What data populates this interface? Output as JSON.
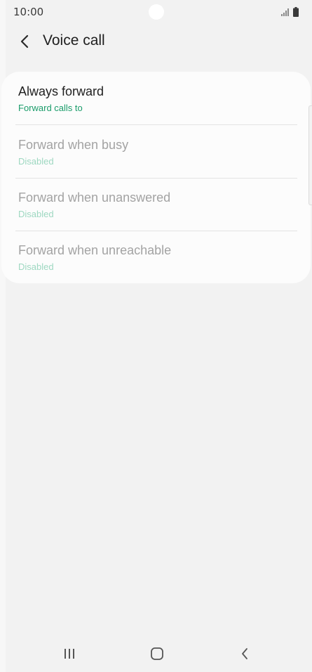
{
  "status_bar": {
    "time": "10:00"
  },
  "header": {
    "title": "Voice call",
    "back_icon": "chevron-left-icon"
  },
  "settings": [
    {
      "title": "Always forward",
      "subtitle": "Forward calls to",
      "enabled": true
    },
    {
      "title": "Forward when busy",
      "subtitle": "Disabled",
      "enabled": false
    },
    {
      "title": "Forward when unanswered",
      "subtitle": "Disabled",
      "enabled": false
    },
    {
      "title": "Forward when unreachable",
      "subtitle": "Disabled",
      "enabled": false
    }
  ],
  "colors": {
    "accent": "#1a9c6a",
    "disabled_text": "#a3a3a3",
    "disabled_subtext": "#9ed8c1",
    "title_text": "#1f1f1f",
    "background": "#f2f2f2",
    "card": "#fcfcfc"
  },
  "nav_bar": {
    "recents_icon": "recents-icon",
    "home_icon": "home-icon",
    "back_icon": "back-icon"
  }
}
